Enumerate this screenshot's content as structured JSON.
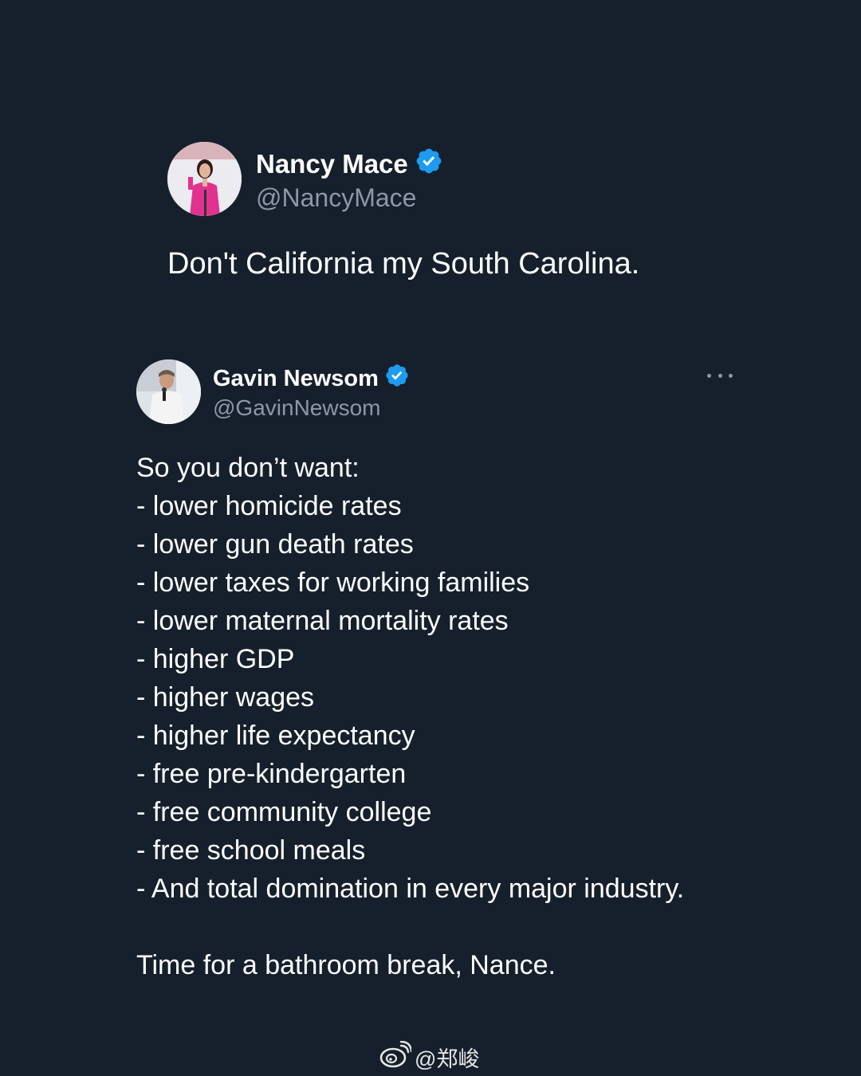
{
  "colors": {
    "background": "#16202c",
    "verified": "#1d9bf0",
    "secondary_text": "#8b98a5"
  },
  "tweet_quoted": {
    "author_name": "Nancy Mace",
    "handle": "@NancyMace",
    "verified_icon": "verified-badge-icon",
    "text": "Don't California my South Carolina."
  },
  "tweet_reply": {
    "author_name": "Gavin Newsom",
    "handle": "@GavinNewsom",
    "verified_icon": "verified-badge-icon",
    "more_icon": "more-options-icon",
    "intro": "So you don’t want:",
    "list": [
      "- lower homicide rates",
      "- lower gun death rates",
      "- lower taxes for working families",
      "- lower maternal mortality rates",
      "- higher GDP",
      "- higher wages",
      "- higher life expectancy",
      "- free pre-kindergarten",
      "- free community college",
      "- free school meals",
      "- And total domination in every major industry."
    ],
    "closing": "Time for a bathroom break, Nance."
  },
  "watermark": {
    "icon": "weibo-logo-icon",
    "text": "@郑峻"
  }
}
